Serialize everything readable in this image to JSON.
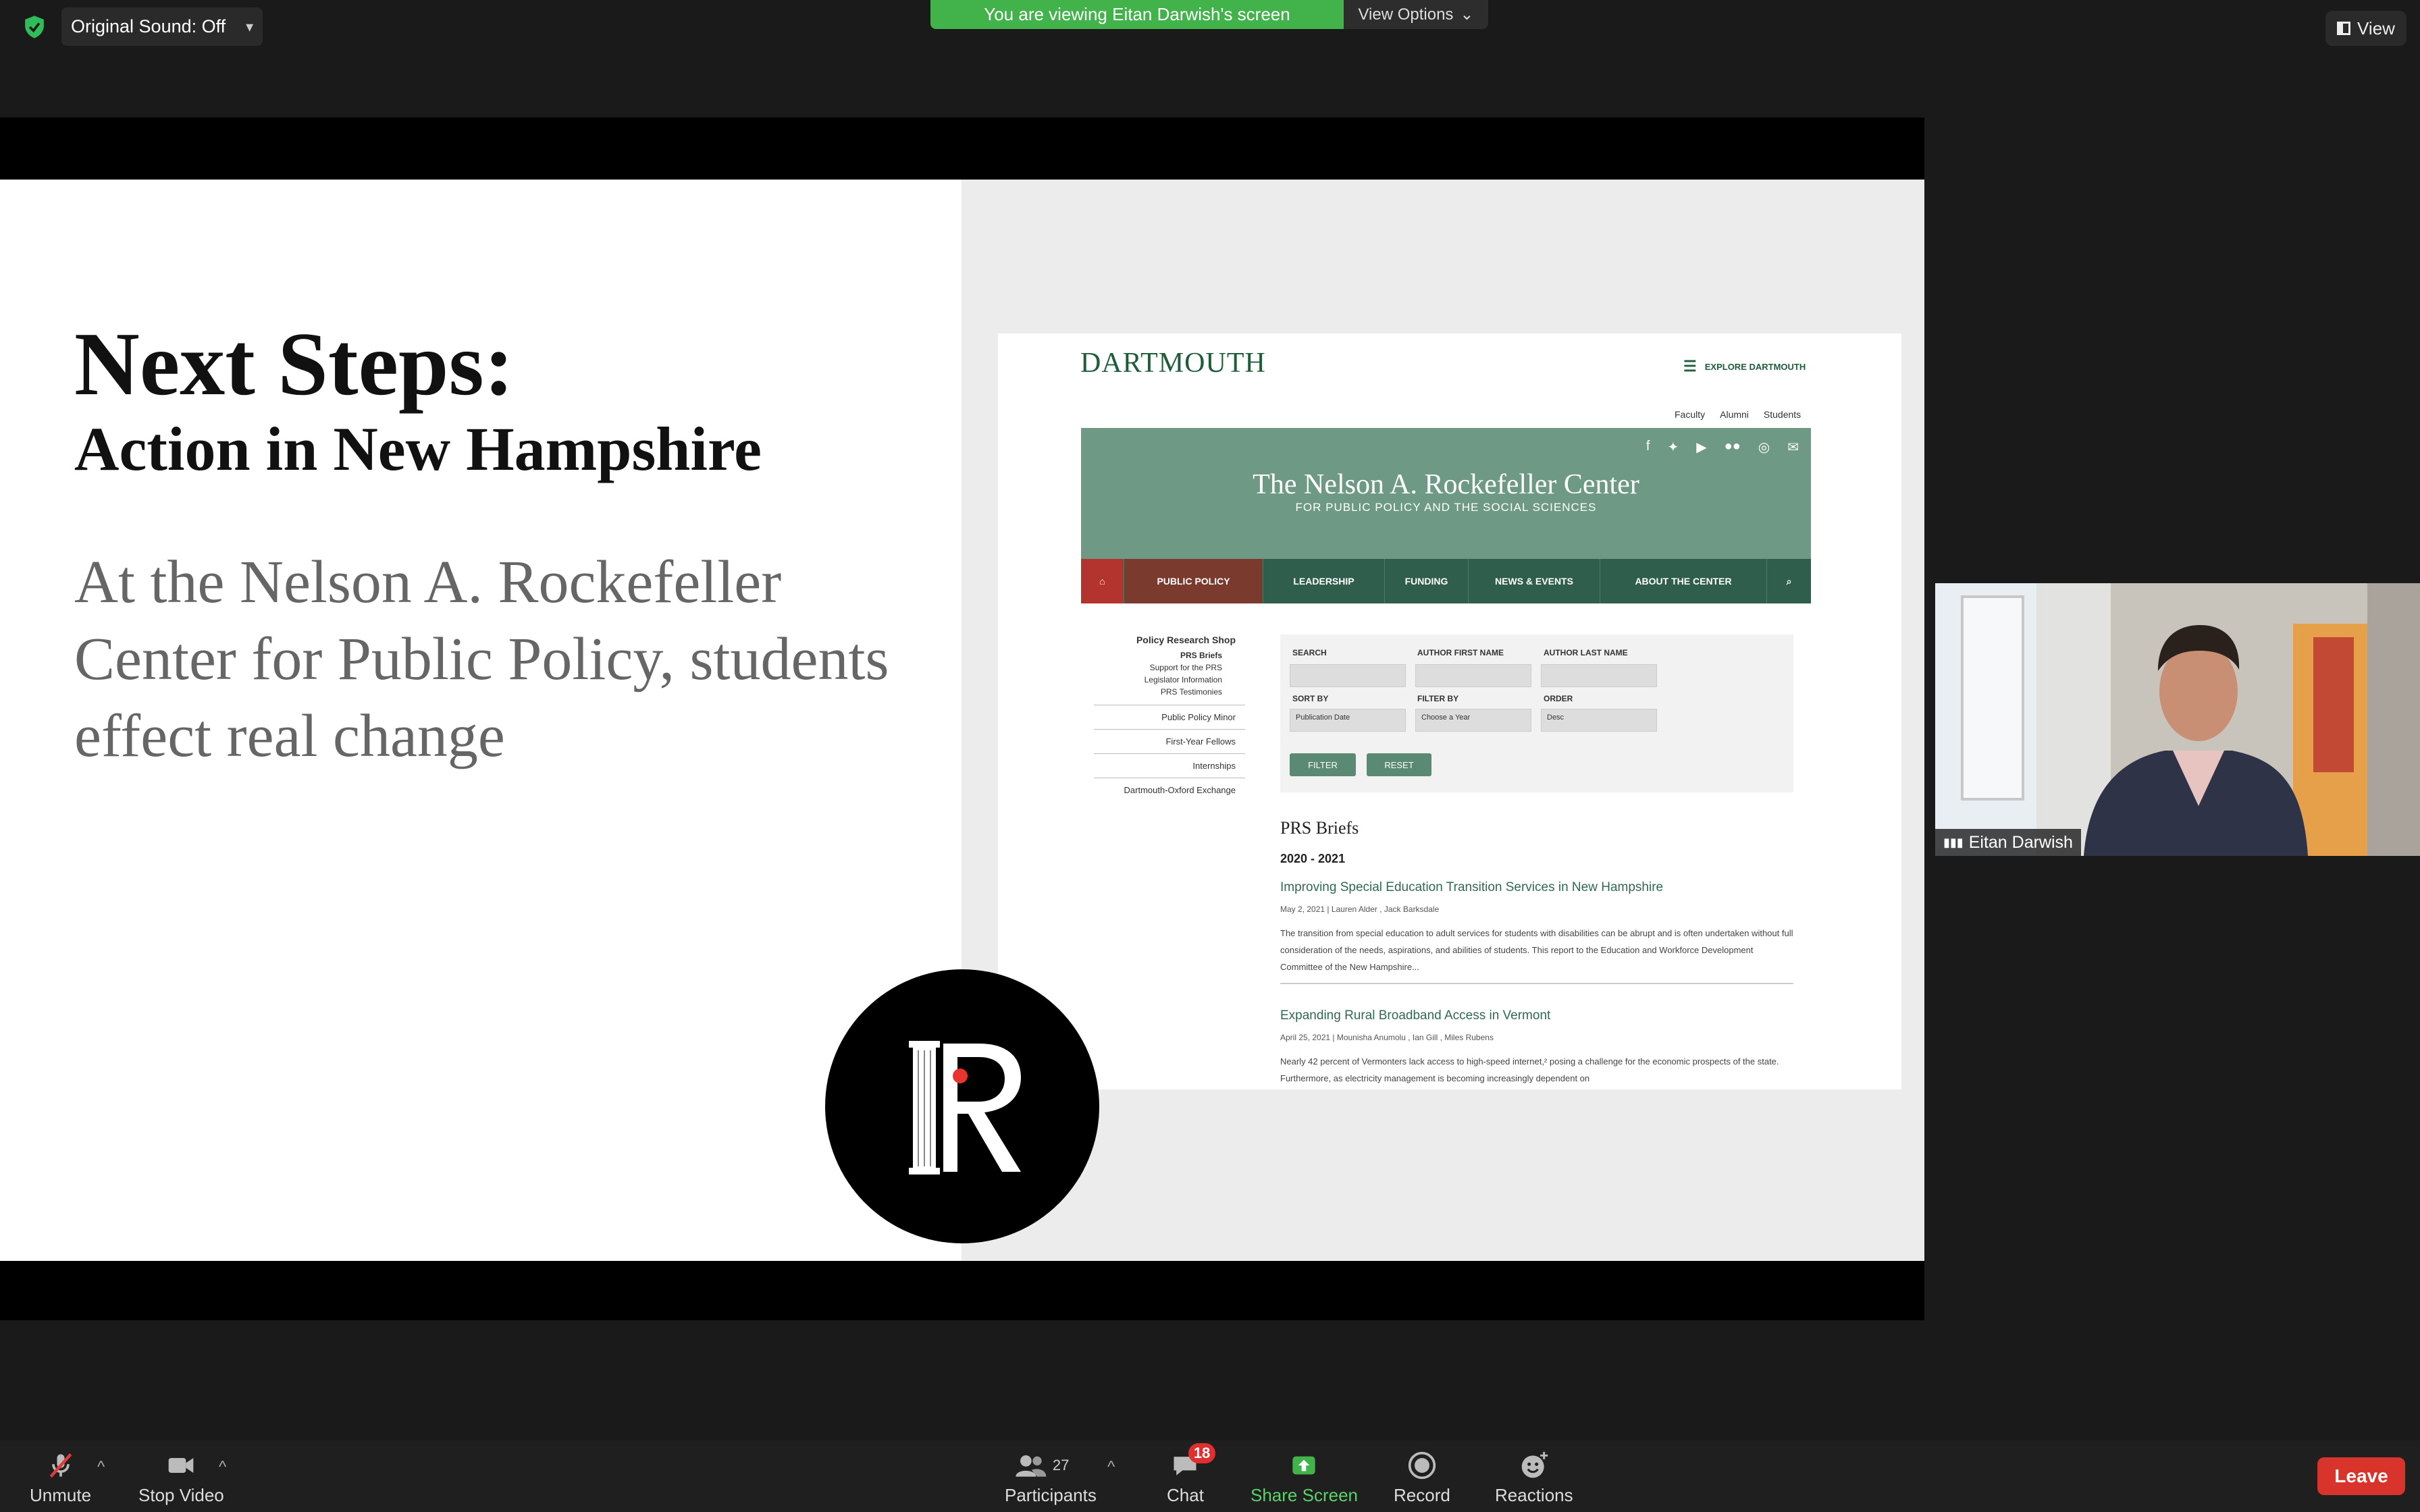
{
  "meeting": {
    "original_sound": "Original Sound: Off",
    "viewing_banner": "You are viewing Eitan Darwish's screen",
    "view_options": "View Options",
    "view_button": "View"
  },
  "slide": {
    "title": "Next Steps:",
    "subtitle": "Action in New Hampshire",
    "body": "At the Nelson A. Rockefeller Center for Public Policy, students effect real change"
  },
  "website": {
    "wordmark": "DARTMOUTH",
    "explore": "EXPLORE DARTMOUTH",
    "top_links": [
      "Faculty",
      "Alumni",
      "Students"
    ],
    "hero_title": "The Nelson A. Rockefeller Center",
    "hero_subtitle": "FOR PUBLIC POLICY AND THE SOCIAL SCIENCES",
    "nav": [
      "PUBLIC POLICY",
      "LEADERSHIP",
      "FUNDING",
      "NEWS & EVENTS",
      "ABOUT THE CENTER"
    ],
    "left_nav": {
      "heading": "Policy Research Shop",
      "items": [
        "PRS Briefs",
        "Support for the PRS",
        "Legislator Information",
        "PRS Testimonies"
      ],
      "sections": [
        "Public Policy Minor",
        "First-Year Fellows",
        "Internships",
        "Dartmouth-Oxford Exchange"
      ]
    },
    "search": {
      "search_label": "SEARCH",
      "first_name_label": "AUTHOR FIRST NAME",
      "last_name_label": "AUTHOR LAST NAME",
      "sort_label": "SORT BY",
      "sort_value": "Publication Date",
      "filter_label": "FILTER BY",
      "filter_value": "Choose a Year",
      "order_label": "ORDER",
      "order_value": "Desc",
      "filter_button": "FILTER",
      "reset_button": "RESET"
    },
    "briefs_heading": "PRS Briefs",
    "year": "2020 - 2021",
    "articles": [
      {
        "title": "Improving Special Education Transition Services in New Hampshire",
        "meta": "May 2, 2021  |  Lauren Alder , Jack Barksdale",
        "text": "The transition from special education to adult services for students with disabilities can be abrupt and is often undertaken without full consideration of the needs, aspirations, and abilities of students. This report to the Education and Workforce Development Committee of the New Hampshire..."
      },
      {
        "title": "Expanding Rural Broadband Access in Vermont",
        "meta": "April 25, 2021  |  Mounisha Anumolu , Ian Gill , Miles Rubens",
        "text": "Nearly 42 percent of Vermonters lack access to high-speed internet,² posing a challenge for the economic prospects of the state. Furthermore, as electricity management is becoming increasingly dependent on"
      }
    ]
  },
  "participant": {
    "name": "Eitan Darwish"
  },
  "toolbar": {
    "unmute": "Unmute",
    "stop_video": "Stop Video",
    "participants": "Participants",
    "participants_count": "27",
    "chat": "Chat",
    "chat_badge": "18",
    "share_screen": "Share Screen",
    "record": "Record",
    "reactions": "Reactions",
    "leave": "Leave"
  },
  "colors": {
    "banner_green": "#41b34a",
    "leave_red": "#d9342b",
    "share_green": "#41b34a",
    "dartmouth_green": "#1e5c3a"
  }
}
